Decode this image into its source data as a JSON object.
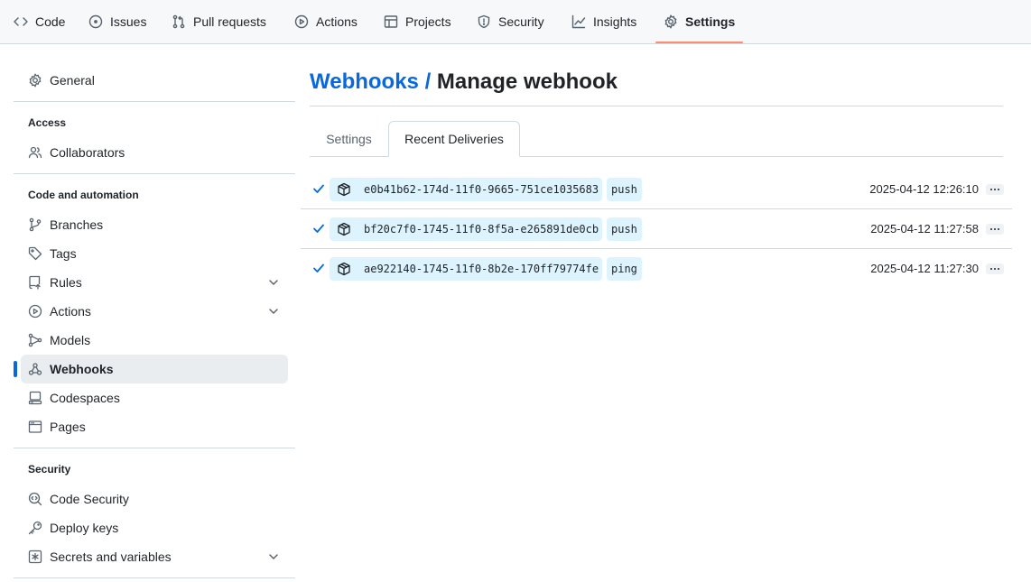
{
  "nav": {
    "tabs": [
      {
        "label": "Code",
        "icon": "code-icon"
      },
      {
        "label": "Issues",
        "icon": "issue-opened-icon"
      },
      {
        "label": "Pull requests",
        "icon": "git-pull-request-icon"
      },
      {
        "label": "Actions",
        "icon": "play-icon"
      },
      {
        "label": "Projects",
        "icon": "table-icon"
      },
      {
        "label": "Security",
        "icon": "shield-icon"
      },
      {
        "label": "Insights",
        "icon": "graph-icon"
      },
      {
        "label": "Settings",
        "icon": "gear-icon",
        "active": true
      }
    ],
    "active_underline_color": "#fd8c73"
  },
  "sidebar": {
    "general": "General",
    "access_heading": "Access",
    "collaborators": "Collaborators",
    "automation_heading": "Code and automation",
    "branches": "Branches",
    "tags": "Tags",
    "rules": "Rules",
    "actions": "Actions",
    "models": "Models",
    "webhooks": "Webhooks",
    "codespaces": "Codespaces",
    "pages": "Pages",
    "security_heading": "Security",
    "code_security": "Code Security",
    "deploy_keys": "Deploy keys",
    "secrets": "Secrets and variables",
    "active_item": "Webhooks",
    "accent_color": "#0969da"
  },
  "main": {
    "breadcrumb": "Webhooks /",
    "title": "Manage webhook",
    "tabs": {
      "settings": "Settings",
      "recent": "Recent Deliveries"
    },
    "active_tab": "Recent Deliveries",
    "deliveries": [
      {
        "guid": "e0b41b62-174d-11f0-9665-751ce1035683",
        "event": "push",
        "time": "2025-04-12 12:26:10",
        "status": "success"
      },
      {
        "guid": "bf20c7f0-1745-11f0-8f5a-e265891de0cb",
        "event": "push",
        "time": "2025-04-12 11:27:58",
        "status": "success"
      },
      {
        "guid": "ae922140-1745-11f0-8b2e-170ff79774fe",
        "event": "ping",
        "time": "2025-04-12 11:27:30",
        "status": "success"
      }
    ]
  }
}
